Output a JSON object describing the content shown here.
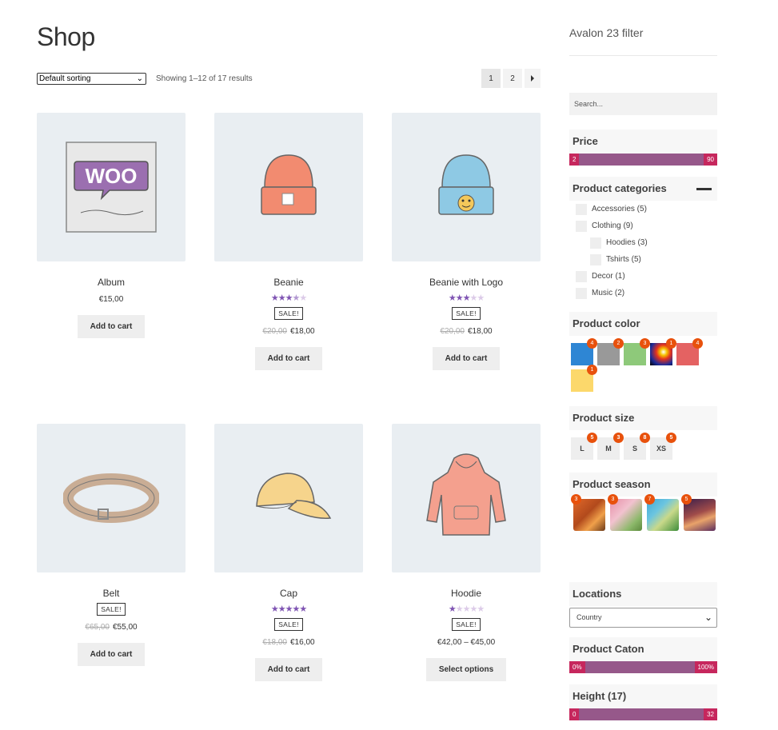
{
  "page": {
    "title": "Shop"
  },
  "toolbar": {
    "sort_value": "Default sorting",
    "result_count": "Showing 1–12 of 17 results",
    "pages": [
      "1",
      "2"
    ],
    "next_icon": "triangle-right-icon"
  },
  "products": [
    {
      "title": "Album",
      "price": "€15,00",
      "button": "Add to cart",
      "image_icon": "woo-album-image"
    },
    {
      "title": "Beanie",
      "rating": 3.5,
      "stars": [
        "★",
        "★",
        "★",
        "★",
        "★"
      ],
      "sale": "SALE!",
      "old_price": "€20,00",
      "price": "€18,00",
      "button": "Add to cart",
      "image_icon": "beanie-image"
    },
    {
      "title": "Beanie with Logo",
      "rating": 3,
      "stars": [
        "★",
        "★",
        "★",
        "★",
        "★"
      ],
      "sale": "SALE!",
      "old_price": "€20,00",
      "price": "€18,00",
      "button": "Add to cart",
      "image_icon": "beanie-logo-image"
    },
    {
      "title": "Belt",
      "sale": "SALE!",
      "old_price": "€65,00",
      "price": "€55,00",
      "button": "Add to cart",
      "image_icon": "belt-image"
    },
    {
      "title": "Cap",
      "rating": 5,
      "stars": [
        "★",
        "★",
        "★",
        "★",
        "★"
      ],
      "sale": "SALE!",
      "old_price": "€18,00",
      "price": "€16,00",
      "button": "Add to cart",
      "image_icon": "cap-image"
    },
    {
      "title": "Hoodie",
      "rating": 1,
      "stars": [
        "★",
        "★",
        "★",
        "★",
        "★"
      ],
      "sale": "SALE!",
      "price": "€42,00 – €45,00",
      "button": "Select options",
      "image_icon": "hoodie-image"
    }
  ],
  "sidebar": {
    "title": "Avalon 23 filter",
    "search_placeholder": "Search...",
    "price": {
      "title": "Price",
      "min": "2",
      "max": "90"
    },
    "categories": {
      "title": "Product categories",
      "items": [
        {
          "label": "Accessories (5)",
          "level": 0
        },
        {
          "label": "Clothing (9)",
          "level": 0
        },
        {
          "label": "Hoodies (3)",
          "level": 1
        },
        {
          "label": "Tshirts (5)",
          "level": 1
        },
        {
          "label": "Decor (1)",
          "level": 0
        },
        {
          "label": "Music (2)",
          "level": 0
        }
      ]
    },
    "colors": {
      "title": "Product color",
      "items": [
        {
          "color": "#2e86d4",
          "count": "4"
        },
        {
          "color": "#999999",
          "count": "2"
        },
        {
          "color": "#8ec97a",
          "count": "3"
        },
        {
          "color": "gradient",
          "count": "1"
        },
        {
          "color": "#e46262",
          "count": "4"
        },
        {
          "color": "#fcd86b",
          "count": "1"
        }
      ]
    },
    "sizes": {
      "title": "Product size",
      "items": [
        {
          "label": "L",
          "count": "5"
        },
        {
          "label": "M",
          "count": "3"
        },
        {
          "label": "S",
          "count": "8"
        },
        {
          "label": "XS",
          "count": "5"
        }
      ]
    },
    "seasons": {
      "title": "Product season",
      "items": [
        {
          "name": "autumn-image",
          "count": "3"
        },
        {
          "name": "spring-image",
          "count": "3"
        },
        {
          "name": "summer-image",
          "count": "7"
        },
        {
          "name": "winter-image",
          "count": "5"
        }
      ]
    },
    "locations": {
      "title": "Locations",
      "value": "Country"
    },
    "caton": {
      "title": "Product Caton",
      "min": "0%",
      "max": "100%"
    },
    "height": {
      "title": "Height (17)",
      "min": "0",
      "max": "32"
    }
  }
}
